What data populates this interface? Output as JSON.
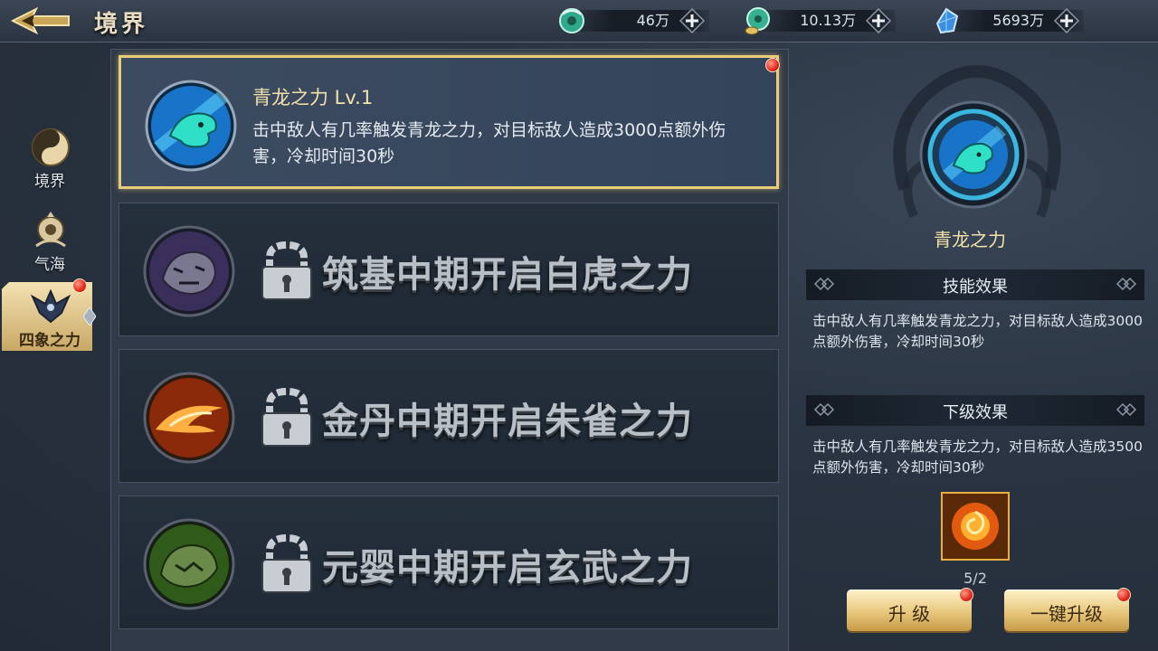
{
  "header": {
    "title": "境界",
    "resources": [
      {
        "icon": "jade-coin-icon",
        "value": "46万"
      },
      {
        "icon": "jade-coin-bag-icon",
        "value": "10.13万"
      },
      {
        "icon": "blue-crystal-icon",
        "value": "5693万"
      }
    ]
  },
  "sidebar": {
    "tabs": [
      {
        "label": "境界",
        "icon": "yin-yang-icon"
      },
      {
        "label": "气海",
        "icon": "lotus-emblem-icon"
      },
      {
        "label": "四象之力",
        "icon": "phoenix-emblem-icon"
      }
    ]
  },
  "powers": [
    {
      "title": "青龙之力  Lv.1",
      "description": "击中敌人有几率触发青龙之力，对目标敌人造成3000点额外伤害，冷却时间30秒",
      "icon": "azure-dragon-icon"
    },
    {
      "lock_text": "筑基中期开启白虎之力",
      "icon": "white-tiger-icon"
    },
    {
      "lock_text": "金丹中期开启朱雀之力",
      "icon": "vermilion-bird-icon"
    },
    {
      "lock_text": "元婴中期开启玄武之力",
      "icon": "black-tortoise-icon"
    }
  ],
  "detail": {
    "skill_name": "青龙之力",
    "effect_header": "技能效果",
    "effect_text": "击中敌人有几率触发青龙之力，对目标敌人造成3000点额外伤害，冷却时间30秒",
    "next_header": "下级效果",
    "next_text": "击中敌人有几率触发青龙之力，对目标敌人造成3500点额外伤害，冷却时间30秒",
    "material_icon": "fire-orb-icon",
    "material_count": "5/2",
    "upgrade_label": "升 级",
    "upgrade_all_label": "一键升级"
  },
  "colors": {
    "accent_gold": "#e8cc7a",
    "dragon_teal": "#2fd0c8",
    "alert_red": "#e22a1a"
  }
}
